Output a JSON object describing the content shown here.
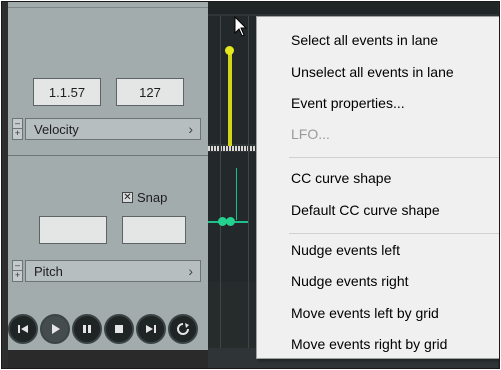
{
  "params_upper": {
    "position": "1.1.57",
    "value": "127",
    "lane": "Velocity"
  },
  "params_lower": {
    "snap_label": "Snap",
    "snap_checked": true,
    "lane": "Pitch",
    "field1": "",
    "field2": ""
  },
  "menu": {
    "items": [
      {
        "label": "Select all events in lane",
        "enabled": true
      },
      {
        "label": "Unselect all events in lane",
        "enabled": true
      },
      {
        "label": "Event properties...",
        "enabled": true
      },
      {
        "label": "LFO...",
        "enabled": false
      },
      {
        "label": "CC curve shape",
        "enabled": true
      },
      {
        "label": "Default CC curve shape",
        "enabled": true
      },
      {
        "label": "Nudge events left",
        "enabled": true
      },
      {
        "label": "Nudge events right",
        "enabled": true
      },
      {
        "label": "Move events left by grid",
        "enabled": true
      },
      {
        "label": "Move events right by grid",
        "enabled": true
      }
    ]
  },
  "transport": [
    {
      "name": "go-to-start",
      "icon": "skip-back-icon"
    },
    {
      "name": "play",
      "icon": "play-icon"
    },
    {
      "name": "pause",
      "icon": "pause-icon"
    },
    {
      "name": "stop",
      "icon": "stop-icon"
    },
    {
      "name": "go-to-end",
      "icon": "skip-forward-icon"
    },
    {
      "name": "loop",
      "icon": "loop-icon"
    }
  ],
  "colors": {
    "velocity": "#d3d617",
    "pitch": "#24d28f",
    "panel": "#a3acad"
  },
  "glyphs": {
    "chevron": "›",
    "expand": "+",
    "collapse": "–",
    "check": "✕"
  }
}
